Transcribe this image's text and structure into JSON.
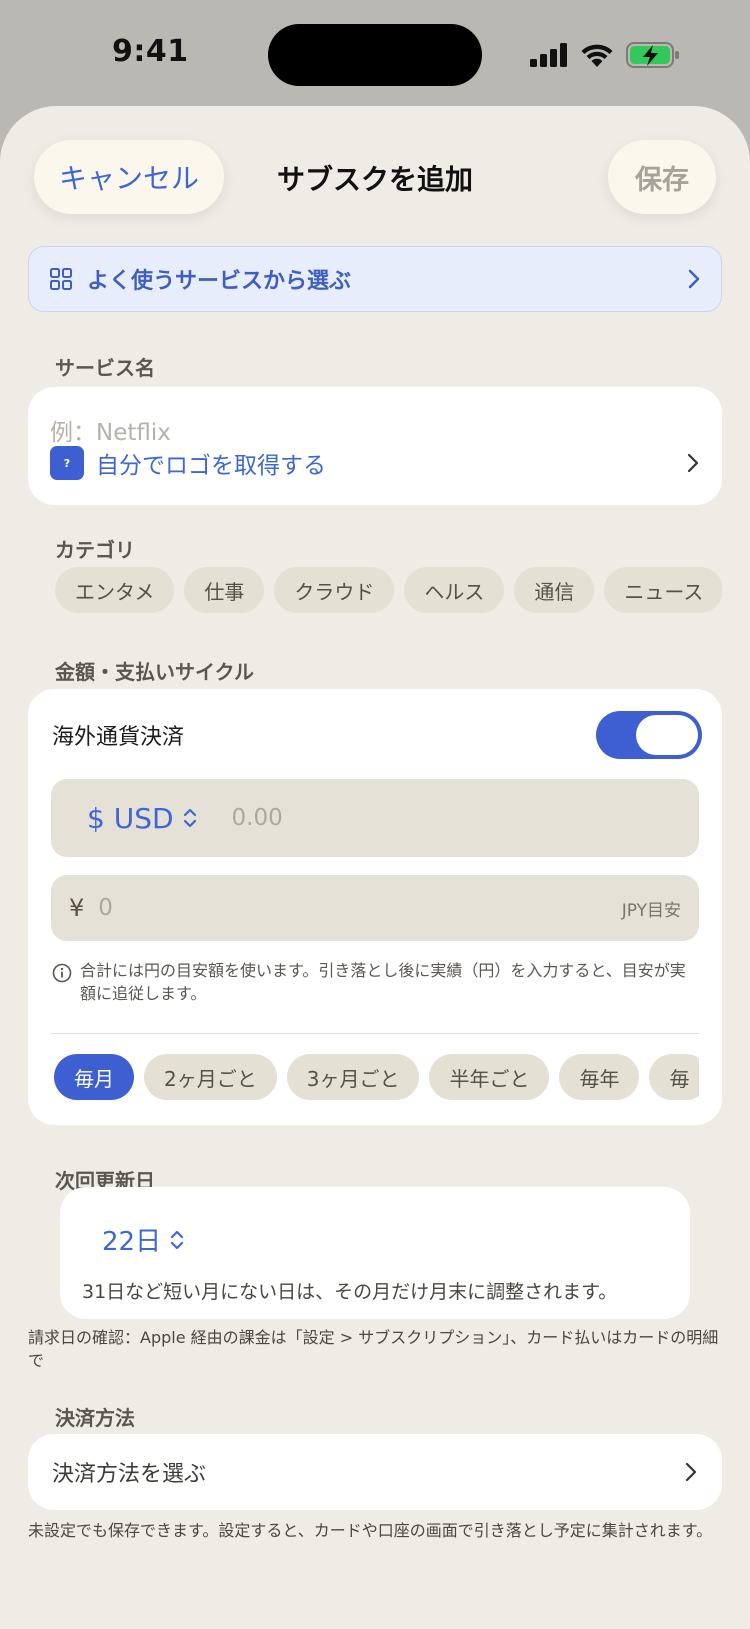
{
  "status_bar": {
    "time": "9:41"
  },
  "nav": {
    "cancel_label": "キャンセル",
    "title": "サブスクを追加",
    "save_label": "保存"
  },
  "quick_pick": {
    "label": "よく使うサービスから選ぶ"
  },
  "service_name": {
    "section_label": "サービス名",
    "placeholder": "例：Netflix",
    "logo_badge": "?",
    "logo_link": "自分でロゴを取得する"
  },
  "category": {
    "section_label": "カテゴリ",
    "chips": [
      "エンタメ",
      "仕事",
      "クラウド",
      "ヘルス",
      "通信",
      "ニュース"
    ]
  },
  "amount": {
    "section_label": "金額・支払いサイクル",
    "foreign_toggle_label": "海外通貨決済",
    "foreign_toggle_on": true,
    "currency": "$ USD",
    "amount_placeholder": "0.00",
    "yen_symbol": "¥",
    "jpy_placeholder": "0",
    "jpy_hint": "JPY目安",
    "info_text": "合計には円の目安額を使います。引き落とし後に実績（円）を入力すると、目安が実額に追従します。",
    "cycles": [
      "毎月",
      "2ヶ月ごと",
      "3ヶ月ごと",
      "半年ごと",
      "毎年",
      "毎"
    ],
    "selected_cycle": "毎月"
  },
  "next_renewal": {
    "section_label": "次回更新日",
    "day": "22日",
    "note": "31日など短い月にない日は、その月だけ月末に調整されます。",
    "footnote": "請求日の確認：Apple 経由の課金は「設定 > サブスクリプション」、カード払いはカードの明細で"
  },
  "payment": {
    "section_label": "決済方法",
    "select_label": "決済方法を選ぶ",
    "footnote": "未設定でも保存できます。設定すると、カードや口座の画面で引き落とし予定に集計されます。"
  },
  "colors": {
    "accent": "#3e5fd1",
    "background": "#efece6",
    "card": "#ffffff"
  }
}
